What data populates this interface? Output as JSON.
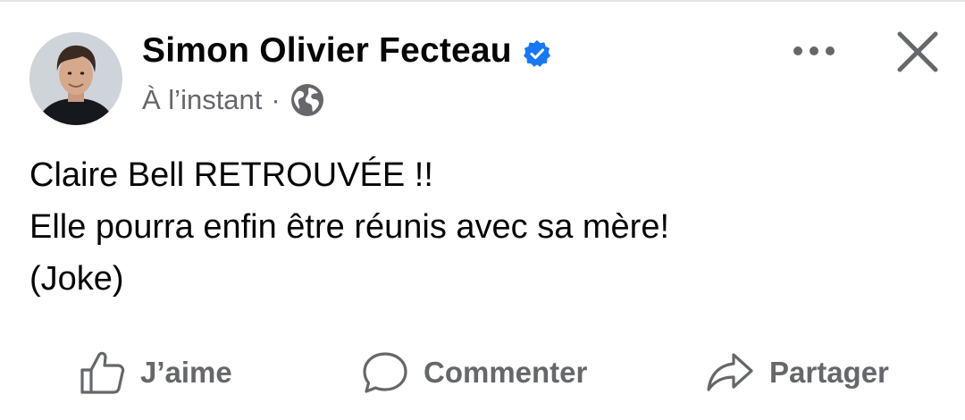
{
  "post": {
    "author": "Simon Olivier Fecteau",
    "time": "À l’instant",
    "separator": "·",
    "audience_icon": "globe-icon",
    "verified_icon": "verified-badge-icon",
    "lines": [
      "Claire Bell RETROUVÉE !!",
      "Elle pourra enfin être réunis avec sa mère!",
      "(Joke)"
    ]
  },
  "header_actions": {
    "more_icon": "more-options-icon",
    "close_icon": "close-icon"
  },
  "actions": {
    "like_label": "J’aime",
    "comment_label": "Commenter",
    "share_label": "Partager"
  },
  "colors": {
    "verified": "#1877f2",
    "secondary_text": "#65676b",
    "primary_text": "#050505"
  }
}
